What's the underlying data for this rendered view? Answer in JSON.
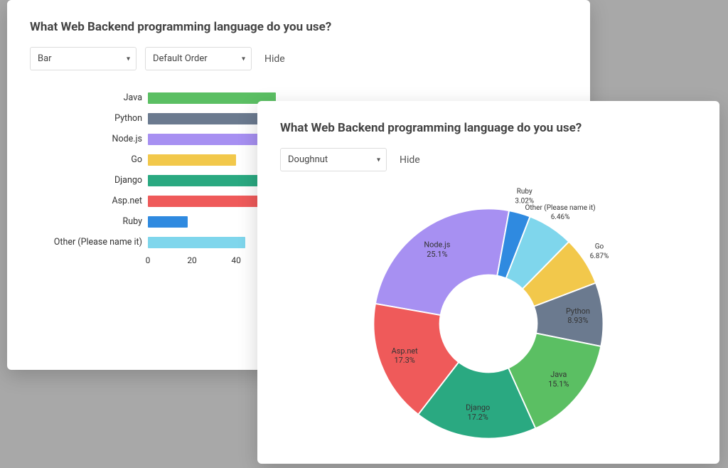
{
  "bar_card": {
    "title": "What Web Backend programming language do you use?",
    "select_type": "Bar",
    "select_order": "Default Order",
    "hide": "Hide"
  },
  "doughnut_card": {
    "title": "What Web Backend programming language do you use?",
    "select_type": "Doughnut",
    "hide": "Hide"
  },
  "chart_data": [
    {
      "type": "bar",
      "orientation": "horizontal",
      "title": "What Web Backend programming language do you use?",
      "xlabel": "",
      "ylabel": "",
      "xlim": [
        0,
        58
      ],
      "ticks": [
        0,
        20,
        40
      ],
      "categories": [
        "Java",
        "Python",
        "Node.js",
        "Go",
        "Django",
        "Asp.net",
        "Ruby",
        "Other (Please name it)"
      ],
      "values": [
        58,
        58,
        58,
        40,
        58,
        58,
        18,
        44
      ],
      "colors": [
        "#5bbf63",
        "#6b7a8f",
        "#a790f2",
        "#f2c84b",
        "#2aa981",
        "#ef5a5a",
        "#2f8ae0",
        "#7fd6ec"
      ]
    },
    {
      "type": "pie",
      "variant": "doughnut",
      "title": "What Web Backend programming language do you use?",
      "series": [
        {
          "name": "Node.js",
          "value": 25.1,
          "color": "#a790f2"
        },
        {
          "name": "Ruby",
          "value": 3.02,
          "color": "#2f8ae0"
        },
        {
          "name": "Other (Please name it)",
          "value": 6.46,
          "color": "#7fd6ec"
        },
        {
          "name": "Go",
          "value": 6.87,
          "color": "#f2c84b"
        },
        {
          "name": "Python",
          "value": 8.93,
          "color": "#6b7a8f"
        },
        {
          "name": "Java",
          "value": 15.1,
          "color": "#5bbf63"
        },
        {
          "name": "Django",
          "value": 17.2,
          "color": "#2aa981"
        },
        {
          "name": "Asp.net",
          "value": 17.3,
          "color": "#ef5a5a"
        }
      ]
    }
  ]
}
